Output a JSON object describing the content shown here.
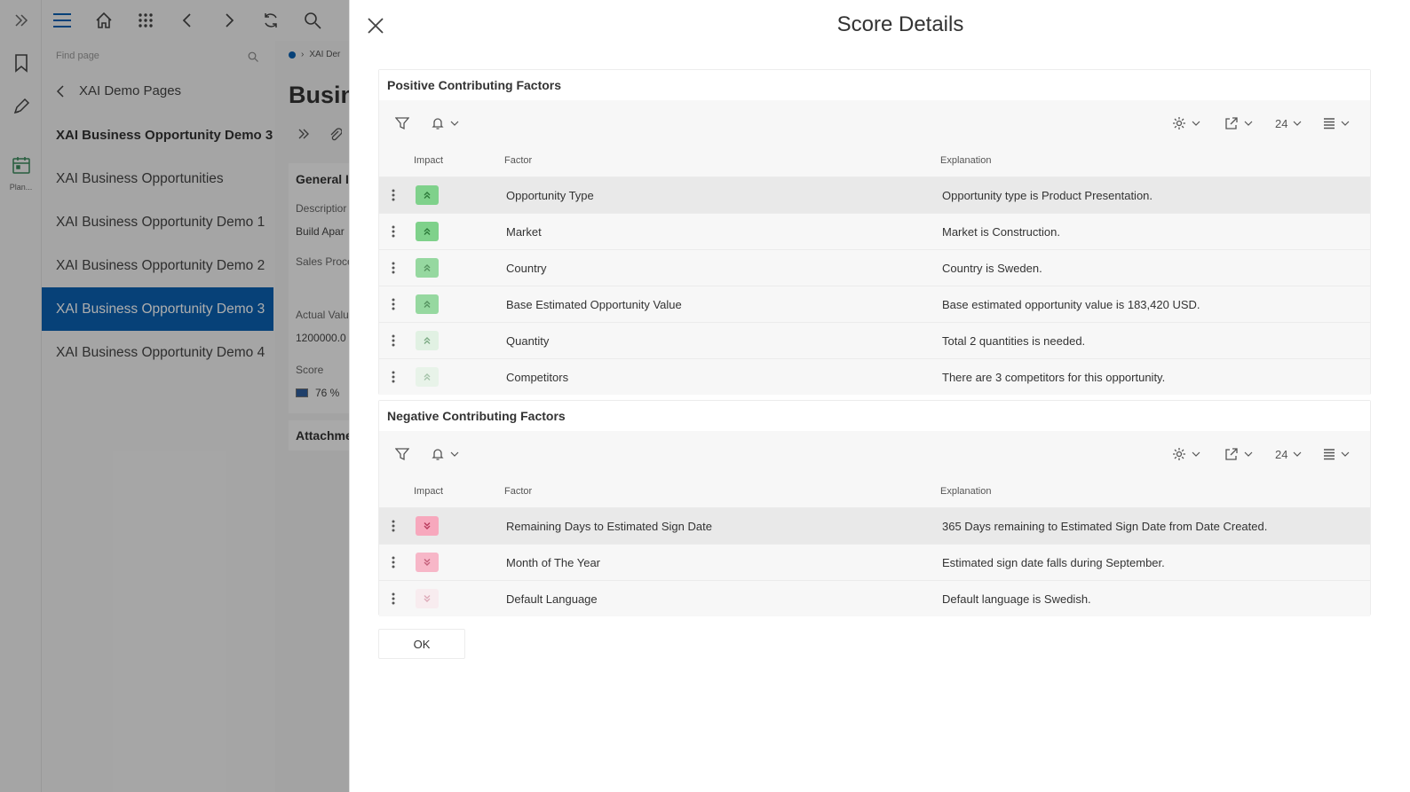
{
  "rail": {
    "plan_label": "Plan..."
  },
  "navigator": {
    "search_placeholder": "Find page",
    "back_label": "XAI Demo Pages",
    "heading": "XAI Business Opportunity Demo 3",
    "items": [
      {
        "label": "XAI Business Opportunities",
        "active": false
      },
      {
        "label": "XAI Business Opportunity Demo 1",
        "active": false
      },
      {
        "label": "XAI Business Opportunity Demo 2",
        "active": false
      },
      {
        "label": "XAI Business Opportunity Demo 3",
        "active": true
      },
      {
        "label": "XAI Business Opportunity Demo 4",
        "active": false
      }
    ]
  },
  "background_page": {
    "breadcrumb": "XAI Der",
    "title": "Busin",
    "card_title": "General I",
    "description_label": "Descriptior",
    "description_value": "Build Apar",
    "sales_process_label": "Sales Proce",
    "actual_value_label": "Actual Valu",
    "actual_value": "1200000.0",
    "score_label": "Score",
    "score_value": "76 %",
    "attachments_title": "Attachme"
  },
  "dialog": {
    "title": "Score Details",
    "ok_label": "OK",
    "columns": {
      "impact": "Impact",
      "factor": "Factor",
      "explanation": "Explanation"
    },
    "page_size": "24",
    "colors": {
      "positive_strong": "#7fd18b",
      "positive_weak": "#d3eed6",
      "negative_strong": "#f7a8bd",
      "negative_weak": "#fbdce5",
      "nav_active": "#0b61b2"
    },
    "positive": {
      "title": "Positive Contributing Factors",
      "rows": [
        {
          "factor": "Opportunity Type",
          "explanation": "Opportunity type is Product Presentation.",
          "strength": "strong"
        },
        {
          "factor": "Market",
          "explanation": "Market is Construction.",
          "strength": "strong"
        },
        {
          "factor": "Country",
          "explanation": "Country is Sweden.",
          "strength": "medium"
        },
        {
          "factor": "Base Estimated Opportunity Value",
          "explanation": "Base estimated opportunity value is 183,420 USD.",
          "strength": "medium"
        },
        {
          "factor": "Quantity",
          "explanation": "Total 2 quantities is needed.",
          "strength": "weak"
        },
        {
          "factor": "Competitors",
          "explanation": "There are 3 competitors for this opportunity.",
          "strength": "faint"
        }
      ]
    },
    "negative": {
      "title": "Negative Contributing Factors",
      "rows": [
        {
          "factor": "Remaining Days to Estimated Sign Date",
          "explanation": "365 Days remaining to Estimated Sign Date from Date Created.",
          "strength": "strong"
        },
        {
          "factor": "Month of The Year",
          "explanation": "Estimated sign date falls during September.",
          "strength": "medium"
        },
        {
          "factor": "Default Language",
          "explanation": "Default language is Swedish.",
          "strength": "faint"
        }
      ]
    }
  }
}
